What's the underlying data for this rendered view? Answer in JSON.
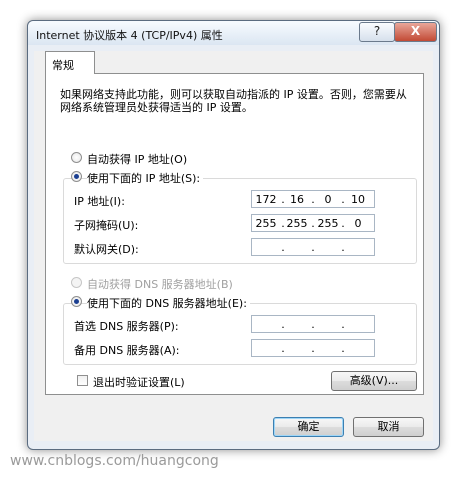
{
  "window": {
    "title": "Internet 协议版本 4 (TCP/IPv4) 属性",
    "help_label": "?",
    "close_label": "X"
  },
  "tab": {
    "label": "常规"
  },
  "description": "如果网络支持此功能，则可以获取自动指派的 IP 设置。否则，您需要从网络系统管理员处获得适当的 IP 设置。",
  "ip_section": {
    "auto_label": "自动获得 IP 地址(O)",
    "manual_label": "使用下面的 IP 地址(S):",
    "selected": "manual",
    "fields": [
      {
        "label": "IP 地址(I):",
        "octets": [
          "172",
          "16",
          "0",
          "10"
        ]
      },
      {
        "label": "子网掩码(U):",
        "octets": [
          "255",
          "255",
          "255",
          "0"
        ]
      },
      {
        "label": "默认网关(D):",
        "octets": [
          "",
          "",
          "",
          ""
        ]
      }
    ]
  },
  "dns_section": {
    "auto_label": "自动获得 DNS 服务器地址(B)",
    "manual_label": "使用下面的 DNS 服务器地址(E):",
    "selected": "manual",
    "auto_disabled": true,
    "fields": [
      {
        "label": "首选 DNS 服务器(P):",
        "octets": [
          "",
          "",
          "",
          ""
        ]
      },
      {
        "label": "备用 DNS 服务器(A):",
        "octets": [
          "",
          "",
          "",
          ""
        ]
      }
    ]
  },
  "validate": {
    "label": "退出时验证设置(L)",
    "checked": false
  },
  "buttons": {
    "advanced": "高级(V)...",
    "ok": "确定",
    "cancel": "取消"
  },
  "watermark": "www.cnblogs.com/huangcong"
}
